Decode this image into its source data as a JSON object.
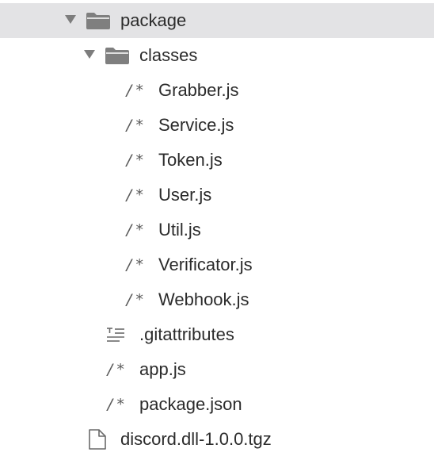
{
  "tree": {
    "package": {
      "label": "package",
      "icon": "folder-open-icon",
      "expanded": true,
      "selected": true
    },
    "classes": {
      "label": "classes",
      "icon": "folder-open-icon",
      "expanded": true
    },
    "class_files": [
      {
        "label": "Grabber.js",
        "icon": "js-file-icon"
      },
      {
        "label": "Service.js",
        "icon": "js-file-icon"
      },
      {
        "label": "Token.js",
        "icon": "js-file-icon"
      },
      {
        "label": "User.js",
        "icon": "js-file-icon"
      },
      {
        "label": "Util.js",
        "icon": "js-file-icon"
      },
      {
        "label": "Verificator.js",
        "icon": "js-file-icon"
      },
      {
        "label": "Webhook.js",
        "icon": "js-file-icon"
      }
    ],
    "package_files": [
      {
        "label": ".gitattributes",
        "icon": "text-file-icon"
      },
      {
        "label": "app.js",
        "icon": "js-file-icon"
      },
      {
        "label": "package.json",
        "icon": "js-file-icon"
      }
    ],
    "root_files": [
      {
        "label": "discord.dll-1.0.0.tgz",
        "icon": "archive-file-icon"
      }
    ],
    "js_icon_glyph": "/*",
    "colors": {
      "selected_row": "#e3e3e5",
      "folder": "#7f7f7f",
      "twisty": "#7d7d7d",
      "text": "#2b2b2b"
    }
  }
}
